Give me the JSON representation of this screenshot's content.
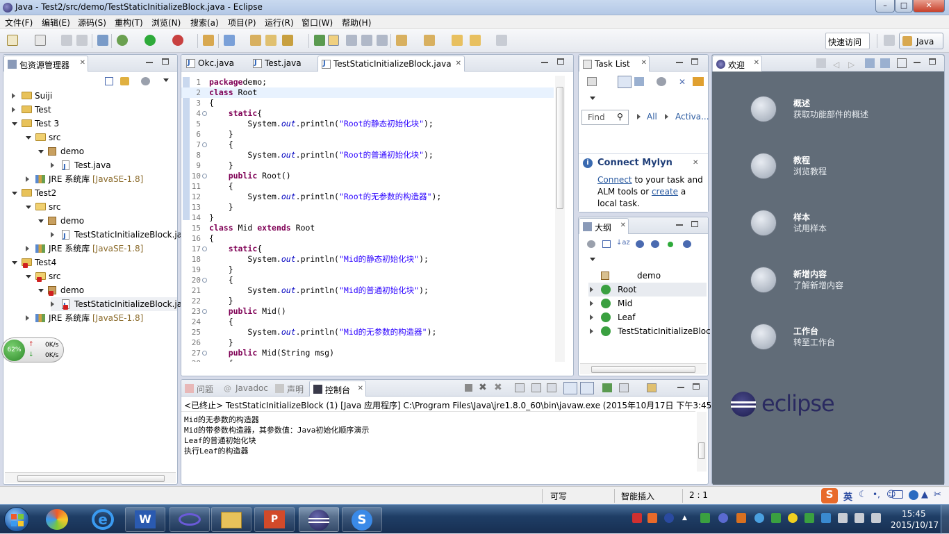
{
  "window": {
    "title": "Java - Test2/src/demo/TestStaticInitializeBlock.java - Eclipse",
    "min": "–",
    "max": "□",
    "close": "✕"
  },
  "menu": [
    "文件(F)",
    "编辑(E)",
    "源码(S)",
    "重构(T)",
    "浏览(N)",
    "搜索(a)",
    "项目(P)",
    "运行(R)",
    "窗口(W)",
    "帮助(H)"
  ],
  "toolbar": {
    "quick_access": "快速访问",
    "perspective": "Java"
  },
  "package_explorer": {
    "title": "包资源管理器",
    "items": [
      {
        "label": "Suiji"
      },
      {
        "label": "Test"
      },
      {
        "label": "Test 3"
      },
      {
        "label": "src"
      },
      {
        "label": "demo"
      },
      {
        "label": "Test.java"
      },
      {
        "label": "JRE 系统库",
        "deco": "[JavaSE-1.8]"
      },
      {
        "label": "Test2"
      },
      {
        "label": "src"
      },
      {
        "label": "demo"
      },
      {
        "label": "TestStaticInitializeBlock.ja"
      },
      {
        "label": "JRE 系统库",
        "deco": "[JavaSE-1.8]"
      },
      {
        "label": "Test4"
      },
      {
        "label": "src"
      },
      {
        "label": "demo"
      },
      {
        "label": "TestStaticInitializeBlock.ja"
      },
      {
        "label": "JRE 系统库",
        "deco": "[JavaSE-1.8]"
      }
    ]
  },
  "netmon": {
    "percent": "62%",
    "up": "0K/s",
    "down": "0K/s"
  },
  "editor": {
    "tabs": [
      {
        "label": "Okc.java"
      },
      {
        "label": "Test.java"
      },
      {
        "label": "TestStaticInitializeBlock.java"
      }
    ],
    "lines": [
      {
        "n": "1",
        "segs": [
          [
            "kw",
            "package"
          ],
          [
            "",
            "demo;"
          ]
        ]
      },
      {
        "n": "2",
        "segs": [
          [
            "kw",
            "class"
          ],
          [
            "",
            " Root"
          ]
        ]
      },
      {
        "n": "3",
        "segs": [
          [
            "",
            "{"
          ]
        ]
      },
      {
        "n": "4",
        "segs": [
          [
            "",
            "    "
          ],
          [
            "kw",
            "static"
          ],
          [
            "",
            "{"
          ]
        ]
      },
      {
        "n": "5",
        "segs": [
          [
            "",
            "        System."
          ],
          [
            "fi",
            "out"
          ],
          [
            "",
            ".println("
          ],
          [
            "st",
            "\"Root的静态初始化块\""
          ],
          [
            "",
            ");"
          ]
        ]
      },
      {
        "n": "6",
        "segs": [
          [
            "",
            "    }"
          ]
        ]
      },
      {
        "n": "7",
        "segs": [
          [
            "",
            "    {"
          ]
        ]
      },
      {
        "n": "8",
        "segs": [
          [
            "",
            "        System."
          ],
          [
            "fi",
            "out"
          ],
          [
            "",
            ".println("
          ],
          [
            "st",
            "\"Root的普通初始化块\""
          ],
          [
            "",
            ");"
          ]
        ]
      },
      {
        "n": "9",
        "segs": [
          [
            "",
            "    }"
          ]
        ]
      },
      {
        "n": "10",
        "segs": [
          [
            "",
            "    "
          ],
          [
            "kw",
            "public"
          ],
          [
            "",
            " Root()"
          ]
        ]
      },
      {
        "n": "11",
        "segs": [
          [
            "",
            "    {"
          ]
        ]
      },
      {
        "n": "12",
        "segs": [
          [
            "",
            "        System."
          ],
          [
            "fi",
            "out"
          ],
          [
            "",
            ".println("
          ],
          [
            "st",
            "\"Root的无参数的构造器\""
          ],
          [
            "",
            ");"
          ]
        ]
      },
      {
        "n": "13",
        "segs": [
          [
            "",
            "    }"
          ]
        ]
      },
      {
        "n": "14",
        "segs": [
          [
            "",
            "}"
          ]
        ]
      },
      {
        "n": "15",
        "segs": [
          [
            "kw",
            "class"
          ],
          [
            "",
            " Mid "
          ],
          [
            "kw",
            "extends"
          ],
          [
            "",
            " Root"
          ]
        ]
      },
      {
        "n": "16",
        "segs": [
          [
            "",
            "{"
          ]
        ]
      },
      {
        "n": "17",
        "segs": [
          [
            "",
            "    "
          ],
          [
            "kw",
            "static"
          ],
          [
            "",
            "{"
          ]
        ]
      },
      {
        "n": "18",
        "segs": [
          [
            "",
            "        System."
          ],
          [
            "fi",
            "out"
          ],
          [
            "",
            ".println("
          ],
          [
            "st",
            "\"Mid的静态初始化块\""
          ],
          [
            "",
            ");"
          ]
        ]
      },
      {
        "n": "19",
        "segs": [
          [
            "",
            "    }"
          ]
        ]
      },
      {
        "n": "20",
        "segs": [
          [
            "",
            "    {"
          ]
        ]
      },
      {
        "n": "21",
        "segs": [
          [
            "",
            "        System."
          ],
          [
            "fi",
            "out"
          ],
          [
            "",
            ".println("
          ],
          [
            "st",
            "\"Mid的普通初始化块\""
          ],
          [
            "",
            ");"
          ]
        ]
      },
      {
        "n": "22",
        "segs": [
          [
            "",
            "    }"
          ]
        ]
      },
      {
        "n": "23",
        "segs": [
          [
            "",
            "    "
          ],
          [
            "kw",
            "public"
          ],
          [
            "",
            " Mid()"
          ]
        ]
      },
      {
        "n": "24",
        "segs": [
          [
            "",
            "    {"
          ]
        ]
      },
      {
        "n": "25",
        "segs": [
          [
            "",
            "        System."
          ],
          [
            "fi",
            "out"
          ],
          [
            "",
            ".println("
          ],
          [
            "st",
            "\"Mid的无参数的构造器\""
          ],
          [
            "",
            ");"
          ]
        ]
      },
      {
        "n": "26",
        "segs": [
          [
            "",
            "    }"
          ]
        ]
      },
      {
        "n": "27",
        "segs": [
          [
            "",
            "    "
          ],
          [
            "kw",
            "public"
          ],
          [
            "",
            " Mid(String msg)"
          ]
        ]
      },
      {
        "n": "28",
        "segs": [
          [
            "",
            "    {"
          ]
        ]
      }
    ]
  },
  "task_list": {
    "title": "Task List",
    "find": "Find",
    "all": "All",
    "activate": "Activa..."
  },
  "mylyn": {
    "title": "Connect Mylyn",
    "connect": "Connect",
    "t1": " to your task and",
    "t2": "ALM tools or ",
    "create": "create",
    "t3": " a",
    "t4": "local task."
  },
  "outline": {
    "title": "大纲",
    "items": [
      {
        "label": "demo"
      },
      {
        "label": "Root"
      },
      {
        "label": "Mid"
      },
      {
        "label": "Leaf"
      },
      {
        "label": "TestStaticInitializeBloc"
      }
    ]
  },
  "console": {
    "tabs": [
      {
        "label": "问题"
      },
      {
        "label": "Javadoc"
      },
      {
        "label": "声明"
      },
      {
        "label": "控制台"
      }
    ],
    "header": "<已终止> TestStaticInitializeBlock (1) [Java 应用程序] C:\\Program Files\\Java\\jre1.8.0_60\\bin\\javaw.exe (2015年10月17日 下午3:45:48)",
    "lines": [
      "Mid的无参数的构造器",
      "Mid的带参数构造器，其参数值：Java初始化顺序演示",
      "Leaf的普通初始化块",
      "执行Leaf的构造器"
    ]
  },
  "welcome": {
    "title": "欢迎",
    "items": [
      {
        "h": "概述",
        "s": "获取功能部件的概述"
      },
      {
        "h": "教程",
        "s": "浏览教程"
      },
      {
        "h": "样本",
        "s": "试用样本"
      },
      {
        "h": "新增内容",
        "s": "了解新增内容"
      },
      {
        "h": "工作台",
        "s": "转至工作台"
      }
    ],
    "logo": "eclipse"
  },
  "status": {
    "writable": "可写",
    "insert": "智能插入",
    "pos": "2 : 1"
  },
  "ime": {
    "lang": "英"
  },
  "clock": {
    "time": "15:45",
    "date": "2015/10/17"
  }
}
